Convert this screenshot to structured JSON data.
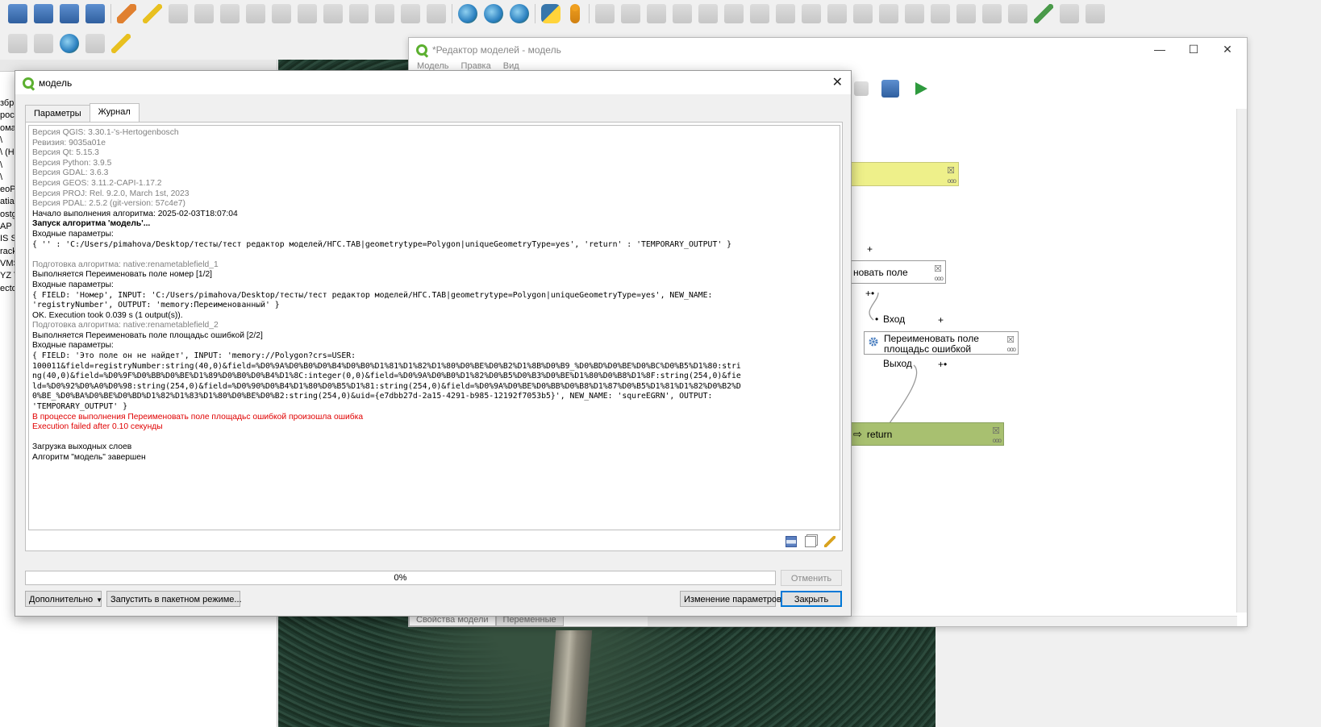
{
  "designer": {
    "title": "*Редактор моделей - модель",
    "menu": [
      "Модель",
      "Правка",
      "Вид"
    ],
    "nodes": {
      "rename1_label": "новать поле",
      "rename2_label_line1": "Переименовать поле",
      "rename2_label_line2": "площадьс ошибкой",
      "input_port": "Вход",
      "output_port": "Выход",
      "return_label": "return"
    },
    "bottom_tabs": [
      "Свойства модели",
      "Переменные"
    ]
  },
  "left_panel_fragments": [
    "збр",
    "рос",
    "ома",
    "\\",
    "\\ (H",
    "\\",
    "\\",
    "eoP",
    "atia",
    "ostg",
    "AP H",
    "IS SC",
    "rack",
    "VMS",
    "YZ T",
    "ecto"
  ],
  "dialog": {
    "title": "модель",
    "tabs": [
      "Параметры",
      "Журнал"
    ],
    "log_lines": [
      {
        "style": "gray",
        "text": "Версия QGIS: 3.30.1-'s-Hertogenbosch"
      },
      {
        "style": "gray",
        "text": "Ревизия: 9035a01e"
      },
      {
        "style": "gray",
        "text": "Версия Qt: 5.15.3"
      },
      {
        "style": "gray",
        "text": "Версия Python: 3.9.5"
      },
      {
        "style": "gray",
        "text": "Версия GDAL: 3.6.3"
      },
      {
        "style": "gray",
        "text": "Версия GEOS: 3.11.2-CAPI-1.17.2"
      },
      {
        "style": "gray",
        "text": "Версия PROJ: Rel. 9.2.0, March 1st, 2023"
      },
      {
        "style": "gray",
        "text": "Версия PDAL: 2.5.2 (git-version: 57c4e7)"
      },
      {
        "style": "normal",
        "text": "Начало выполнения алгоритма: 2025-02-03T18:07:04"
      },
      {
        "style": "bold",
        "text": "Запуск алгоритма 'модель'..."
      },
      {
        "style": "normal",
        "text": "Входные параметры:"
      },
      {
        "style": "mono",
        "text": "{ '' : 'C:/Users/pimahova/Desktop/тесты/тест редактор моделей/НГС.TAB|geometrytype=Polygon|uniqueGeometryType=yes', 'return' : 'TEMPORARY_OUTPUT' }"
      },
      {
        "style": "blank",
        "text": ""
      },
      {
        "style": "gray",
        "text": "Подготовка алгоритма: native:renametablefield_1"
      },
      {
        "style": "normal",
        "text": "Выполняется Переименовать поле номер [1/2]"
      },
      {
        "style": "normal",
        "text": "Входные параметры:"
      },
      {
        "style": "mono",
        "text": "{ FIELD: 'Номер', INPUT: 'C:/Users/pimahova/Desktop/тесты/тест редактор моделей/НГС.TAB|geometrytype=Polygon|uniqueGeometryType=yes', NEW_NAME:"
      },
      {
        "style": "mono",
        "text": "'registryNumber', OUTPUT: 'memory:Переименованный' }"
      },
      {
        "style": "normal",
        "text": "OK. Execution took 0.039 s (1 output(s))."
      },
      {
        "style": "gray",
        "text": "Подготовка алгоритма: native:renametablefield_2"
      },
      {
        "style": "normal",
        "text": "Выполняется Переименовать поле площадьс ошибкой [2/2]"
      },
      {
        "style": "normal",
        "text": "Входные параметры:"
      },
      {
        "style": "mono",
        "text": "{ FIELD: 'Это поле он не найдет', INPUT: 'memory://Polygon?crs=USER:"
      },
      {
        "style": "mono",
        "text": "100011&field=registryNumber:string(40,0)&field=%D0%9A%D0%B0%D0%B4%D0%B0%D1%81%D1%82%D1%80%D0%BE%D0%B2%D1%8B%D0%B9_%D0%BD%D0%BE%D0%BC%D0%B5%D1%80:stri"
      },
      {
        "style": "mono",
        "text": "ng(40,0)&field=%D0%9F%D0%BB%D0%BE%D1%89%D0%B0%D0%B4%D1%8C:integer(0,0)&field=%D0%9A%D0%B0%D1%82%D0%B5%D0%B3%D0%BE%D1%80%D0%B8%D1%8F:string(254,0)&fie"
      },
      {
        "style": "mono",
        "text": "ld=%D0%92%D0%A0%D0%98:string(254,0)&field=%D0%90%D0%B4%D1%80%D0%B5%D1%81:string(254,0)&field=%D0%9A%D0%BE%D0%BB%D0%B8%D1%87%D0%B5%D1%81%D1%82%D0%B2%D"
      },
      {
        "style": "mono",
        "text": "0%BE_%D0%BA%D0%BE%D0%BD%D1%82%D1%83%D1%80%D0%BE%D0%B2:string(254,0)&uid={e7dbb27d-2a15-4291-b985-12192f7053b5}', NEW_NAME: 'squreEGRN', OUTPUT:"
      },
      {
        "style": "mono",
        "text": "'TEMPORARY_OUTPUT' }"
      },
      {
        "style": "red",
        "text": "В процессе выполнения Переименовать поле площадьс ошибкой произошла ошибка"
      },
      {
        "style": "red",
        "text": "Execution failed after 0.10 секунды"
      },
      {
        "style": "blank",
        "text": ""
      },
      {
        "style": "normal",
        "text": "Загрузка выходных слоев"
      },
      {
        "style": "normal",
        "text": "Алгоритм \"модель\" завершен"
      }
    ],
    "progress": "0%",
    "progress_value": 0,
    "buttons": {
      "cancel": "Отменить",
      "advanced": "Дополнительно",
      "batch": "Запустить в пакетном режиме...",
      "change_params": "Изменение параметров",
      "close": "Закрыть"
    }
  },
  "colors": {
    "qgis_green": "#5cb030",
    "error_red": "#e00000",
    "log_gray": "#808080",
    "input_node": "#eef08a",
    "output_node": "#a8c070",
    "accent_blue": "#0078d7"
  }
}
